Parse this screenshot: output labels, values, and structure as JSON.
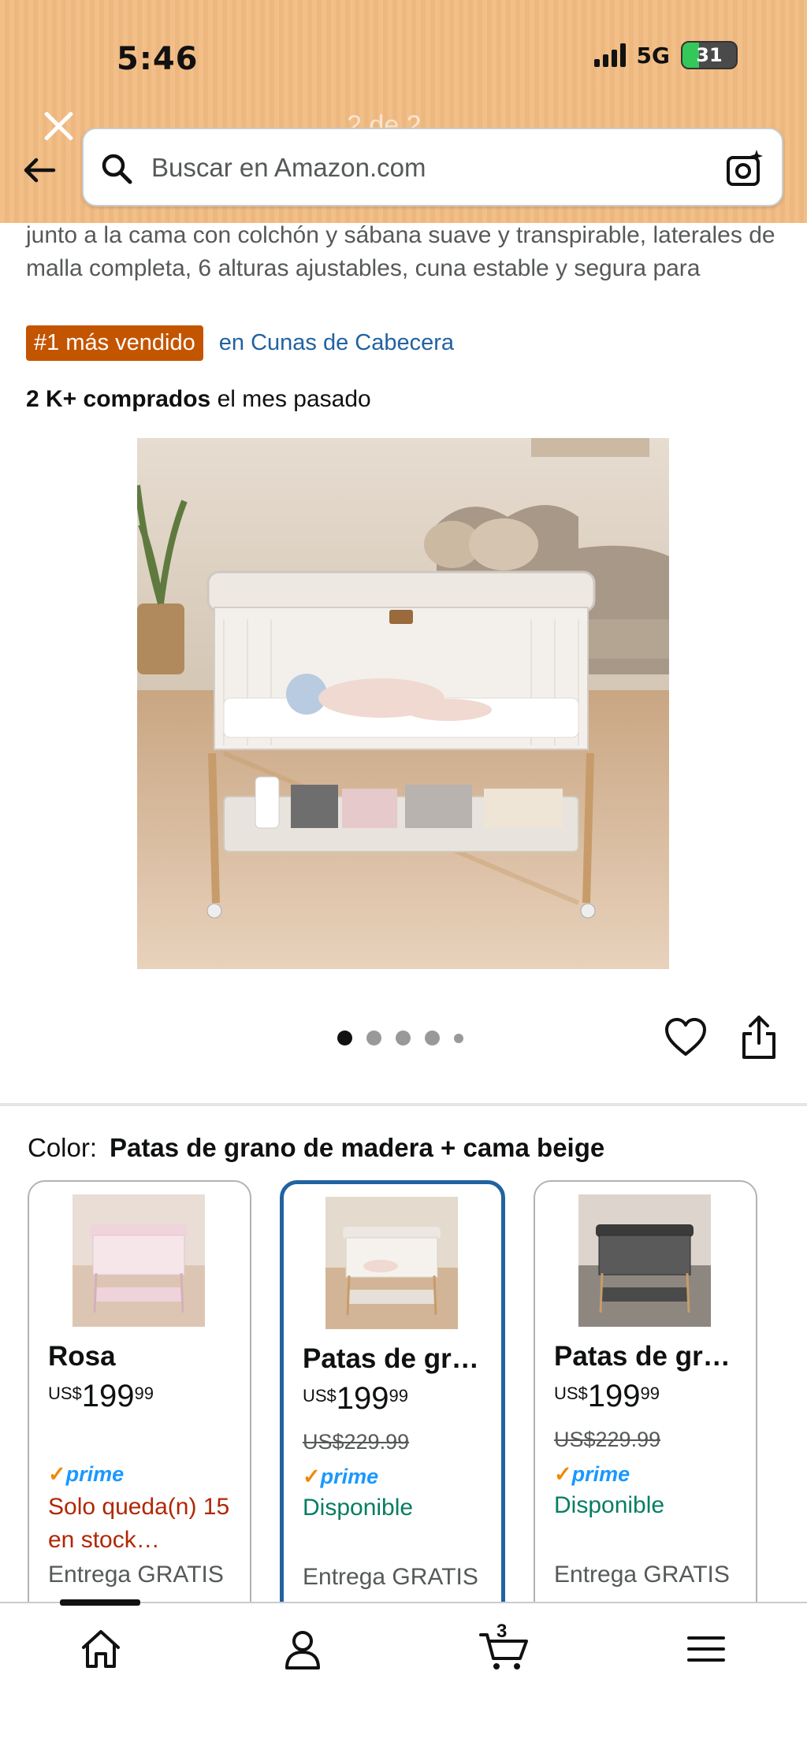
{
  "status_bar": {
    "time": "5:46",
    "network": "5G",
    "battery": "31"
  },
  "viewer": {
    "counter": "2 de 2"
  },
  "search": {
    "placeholder": "Buscar en Amazon.com"
  },
  "product": {
    "title": "junto a la cama con colchón y sábana suave y transpirable, laterales de malla completa, 6 alturas ajustables, cuna estable y segura para",
    "bestseller_badge": "#1 más vendido",
    "bestseller_category": "en Cunas de Cabecera",
    "bought_bold": "2 K+ comprados",
    "bought_rest": " el mes pasado",
    "image_count": 5,
    "active_image": 1
  },
  "color_selector": {
    "label": "Color:",
    "selected_value": "Patas de grano de madera + cama beige",
    "options": [
      {
        "name": "Rosa",
        "currency": "US$",
        "price_whole": "199",
        "price_fraction": "99",
        "list_price": "",
        "prime": "prime",
        "availability": "Solo queda(n) 15 en stock…",
        "delivery": "Entrega GRATIS"
      },
      {
        "name": "Patas de gr…",
        "currency": "US$",
        "price_whole": "199",
        "price_fraction": "99",
        "list_price": "US$229.99",
        "prime": "prime",
        "availability": "Disponible",
        "delivery": "Entrega GRATIS"
      },
      {
        "name": "Patas de gr…",
        "currency": "US$",
        "price_whole": "199",
        "price_fraction": "99",
        "list_price": "US$229.99",
        "prime": "prime",
        "availability": "Disponible",
        "delivery": "Entrega GRATIS"
      }
    ]
  },
  "bottom_nav": {
    "cart_count": "3"
  },
  "colors": {
    "header_bg": "#f2bc82",
    "badge_bg": "#c45500",
    "link": "#2162a1",
    "selected_border": "#2162a1",
    "stock_red": "#b12704",
    "available_green": "#067d62",
    "prime_blue": "#1a98ff",
    "prime_check": "#f08804"
  }
}
